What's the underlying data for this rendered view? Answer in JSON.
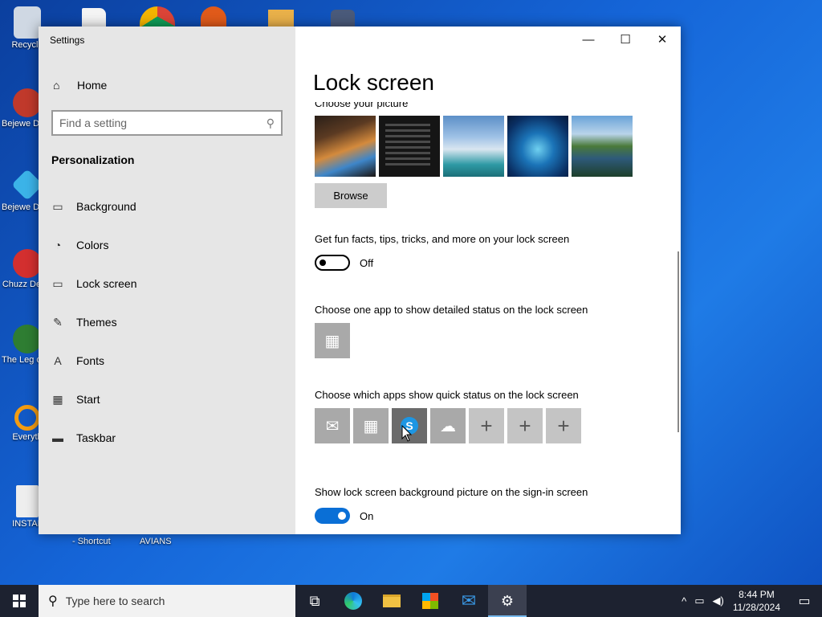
{
  "desktop": {
    "icons": [
      {
        "label": "Recycle",
        "color": "#cfd8e3"
      },
      {
        "label": "Bejewe Delux",
        "color": "#c0392b"
      },
      {
        "label": "Bejewe Delux",
        "color": "#3bb3e8"
      },
      {
        "label": "Chuzz Delux",
        "color": "#d32f2f"
      },
      {
        "label": "The Leg of Zil",
        "color": "#2e7d32"
      },
      {
        "label": "Everyth",
        "color": "#f39c12"
      },
      {
        "label": "INSTAL",
        "color": "#eeeeee"
      }
    ],
    "bottom_labels": [
      "- Shortcut",
      "AVIANS"
    ]
  },
  "window": {
    "title": "Settings",
    "controls": {
      "minimize": "—",
      "maximize": "☐",
      "close": "✕"
    }
  },
  "sidebar": {
    "home": {
      "label": "Home",
      "icon": "home-icon",
      "glyph": "⌂"
    },
    "search": {
      "placeholder": "Find a setting",
      "icon": "search-icon"
    },
    "section": "Personalization",
    "items": [
      {
        "label": "Background",
        "icon": "background-icon",
        "glyph": "▭"
      },
      {
        "label": "Colors",
        "icon": "palette-icon",
        "glyph": "◔"
      },
      {
        "label": "Lock screen",
        "icon": "lock-screen-icon",
        "glyph": "▭"
      },
      {
        "label": "Themes",
        "icon": "themes-icon",
        "glyph": "✎"
      },
      {
        "label": "Fonts",
        "icon": "fonts-icon",
        "glyph": "A"
      },
      {
        "label": "Start",
        "icon": "start-icon",
        "glyph": "▦"
      },
      {
        "label": "Taskbar",
        "icon": "taskbar-icon",
        "glyph": "▬"
      }
    ]
  },
  "content": {
    "title": "Lock screen",
    "clipped_label": "Choose your picture",
    "browse_label": "Browse",
    "fun_facts": {
      "label": "Get fun facts, tips, tricks, and more on your lock screen",
      "state": "Off"
    },
    "detailed_status": {
      "label": "Choose one app to show detailed status on the lock screen"
    },
    "quick_status": {
      "label": "Choose which apps show quick status on the lock screen"
    },
    "signin_bg": {
      "label": "Show lock screen background picture on the sign-in screen",
      "state": "On"
    }
  },
  "taskbar": {
    "search_placeholder": "Type here to search",
    "time": "8:44 PM",
    "date": "11/28/2024",
    "accent": "#76b9ed"
  }
}
